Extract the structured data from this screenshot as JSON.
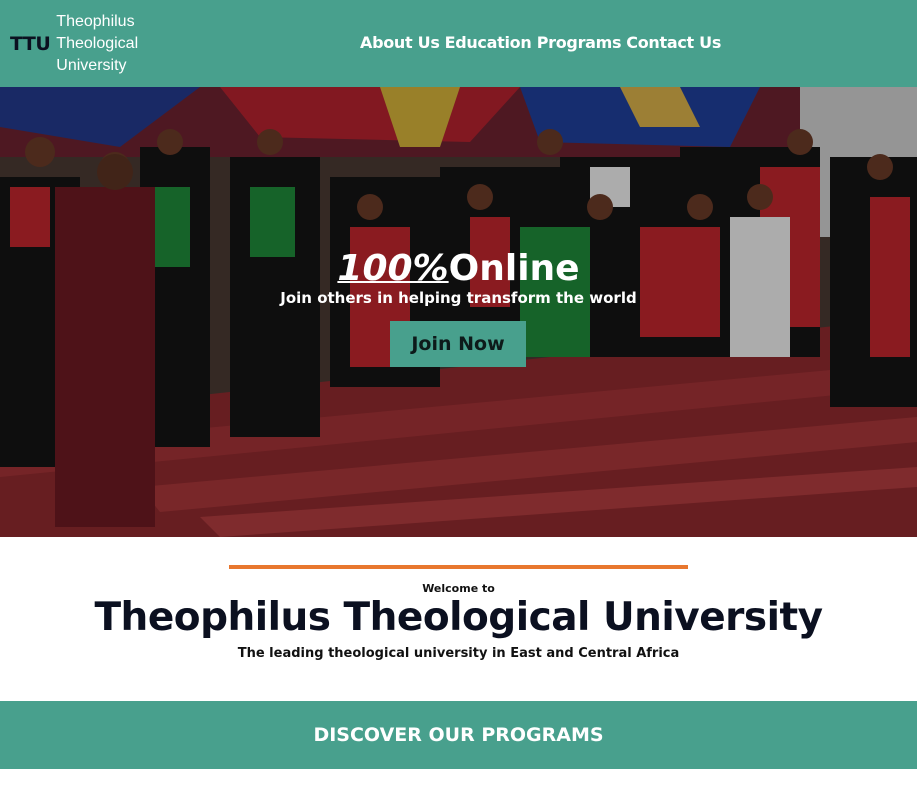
{
  "header": {
    "logo_mark": "TTU",
    "logo_lines": [
      "Theophilus",
      "Theological",
      "University"
    ],
    "nav": [
      "About Us",
      "Education Programs",
      "Contact Us"
    ]
  },
  "hero": {
    "title_em": "100%",
    "title_rest": "Online",
    "subtitle": "Join others in helping transform the world",
    "cta": "Join Now"
  },
  "welcome": {
    "small": "Welcome to",
    "title": "Theophilus Theological University",
    "tagline": "The leading theological university in East and Central Africa"
  },
  "discover": {
    "label": "DISCOVER OUR PROGRAMS"
  },
  "colors": {
    "brand": "#48a08d",
    "accent": "#e8772e",
    "dark": "#0b1020"
  }
}
